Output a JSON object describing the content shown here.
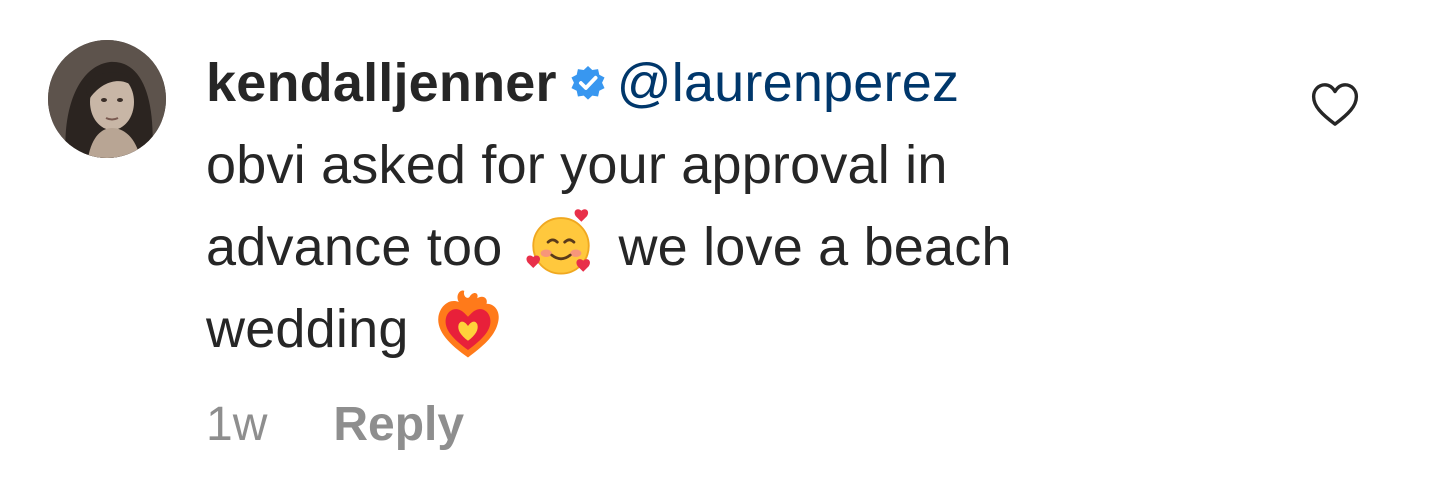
{
  "comment": {
    "author": {
      "username": "kendalljenner",
      "verified": true
    },
    "mention": "@laurenperez",
    "text_line_1": "obvi asked for your approval in",
    "text_line_2a": "advance too",
    "text_line_2b": "we love a beach",
    "text_line_3": "wedding",
    "emojis": [
      "smiling-face-with-hearts-icon",
      "heart-on-fire-icon"
    ],
    "timestamp": "1w",
    "reply_label": "Reply"
  },
  "colors": {
    "text": "#262626",
    "mention": "#00376b",
    "muted": "#8e8e8e",
    "verified": "#3897f0"
  }
}
